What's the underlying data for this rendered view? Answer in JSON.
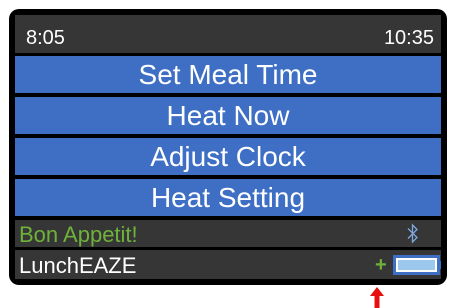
{
  "status_bar": {
    "time_left": "8:05",
    "time_right": "10:35"
  },
  "menu": {
    "items": [
      {
        "label": "Set Meal Time"
      },
      {
        "label": "Heat Now"
      },
      {
        "label": "Adjust Clock"
      },
      {
        "label": "Heat Setting"
      }
    ]
  },
  "message_bar": {
    "message": "Bon Appetit!",
    "icon": "bluetooth-icon"
  },
  "brand_bar": {
    "brand": "LunchEAZE",
    "charging_symbol": "+",
    "battery_icon": "battery-icon"
  },
  "callout": {
    "icon": "arrow-up-icon"
  },
  "colors": {
    "menu_bg": "#3e6fc4",
    "bar_bg": "#363636",
    "message_text": "#6fb23a",
    "battery_fill": "#9cc8ee",
    "arrow": "#e8100e"
  }
}
